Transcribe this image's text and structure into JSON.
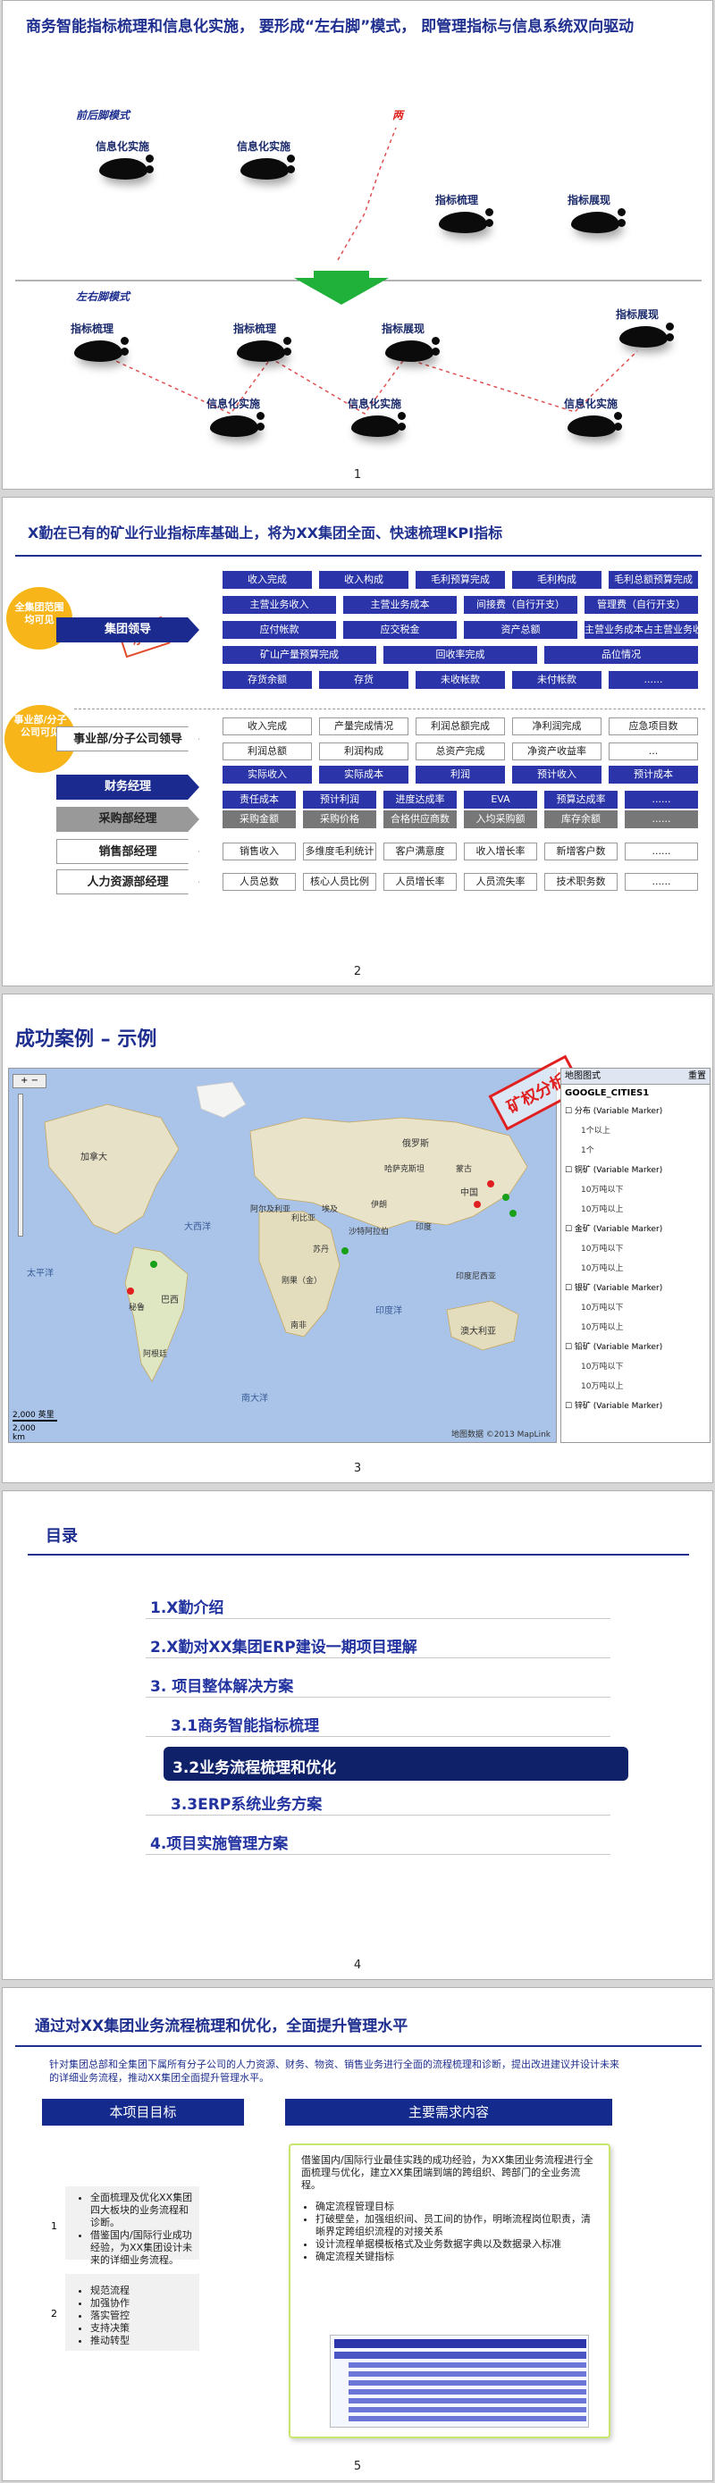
{
  "slide1": {
    "title": "商务智能指标梳理和信息化实施， 要形成“左右脚”模式， 即管理指标与信息系统双向驱动",
    "label_before": "前后脚模式",
    "label_gap": "两",
    "label_after": "左右脚模式",
    "before_feet": [
      "信息化实施",
      "信息化实施",
      "指标梳理",
      "指标展现"
    ],
    "after_top": [
      "指标梳理",
      "指标梳理",
      "指标展现",
      "指标展现"
    ],
    "after_bottom": [
      "信息化实施",
      "信息化实施",
      "信息化实施"
    ],
    "page": "1"
  },
  "slide2": {
    "title": "X勤在已有的矿业行业指标库基础上，将为XX集团全面、快速梳理KPI指标",
    "burst_a": "全集团范围均可见",
    "burst_b": "事业部/分子公司可见",
    "stamp": "示例",
    "rows": [
      {
        "label": "集团领导",
        "rows": [
          [
            "收入完成",
            "收入构成",
            "毛利预算完成",
            "毛利构成",
            "毛利总额预算完成"
          ],
          [
            "主营业务收入",
            "主营业务成本",
            "间接费（自行开支）",
            "管理费（自行开支）"
          ],
          [
            "应付帐款",
            "应交税金",
            "资产总额",
            "主营业务成本占主营业务收入比重"
          ],
          [
            "矿山产量预算完成",
            "回收率完成",
            "品位情况"
          ],
          [
            "存货余额",
            "存货",
            "未收帐款",
            "未付帐款",
            "......"
          ]
        ]
      },
      {
        "label": "事业部/分子公司领导",
        "rows": [
          [
            "收入完成",
            "产量完成情况",
            "利润总额完成",
            "净利润完成",
            "应急项目数"
          ],
          [
            "利润总额",
            "利润构成",
            "总资产完成",
            "净资产收益率",
            "..."
          ]
        ]
      },
      {
        "label": "财务经理",
        "rows": [
          [
            "实际收入",
            "实际成本",
            "利润",
            "预计收入",
            "预计成本"
          ],
          [
            "责任成本",
            "预计利润",
            "进度达成率",
            "EVA",
            "预算达成率",
            "......"
          ]
        ]
      },
      {
        "label": "采购部经理",
        "rows": [
          [
            "采购金额",
            "采购价格",
            "合格供应商数",
            "入均采购额",
            "库存余额",
            "......"
          ]
        ]
      },
      {
        "label": "销售部经理",
        "rows": [
          [
            "销售收入",
            "多维度毛利统计",
            "客户满意度",
            "收入增长率",
            "新增客户数",
            "......"
          ]
        ]
      },
      {
        "label": "人力资源部经理",
        "rows": [
          [
            "人员总数",
            "核心人员比例",
            "人员增长率",
            "人员流失率",
            "技术职务数",
            "......"
          ]
        ]
      }
    ],
    "page": "2"
  },
  "slide3": {
    "title": "成功案例 – 示例",
    "stamp": "矿权分析",
    "map_labels": [
      "加拿大",
      "大西洋",
      "太平洋",
      "印度洋",
      "南大洋",
      "阿尔及利亚",
      "利比亚",
      "埃及",
      "沙特阿拉伯",
      "中国",
      "俄罗斯",
      "哈萨克斯坦",
      "伊朗",
      "巴西",
      "秘鲁",
      "阿根廷",
      "苏丹",
      "刚果（金）",
      "南非",
      "澳大利亚",
      "印度尼西亚",
      "蒙古",
      "印度"
    ],
    "scale": [
      "2,000 英里",
      "2,000 km"
    ],
    "copyright": "地图数据 ©2013 MapLink",
    "panel_title": "地图图式",
    "panel_close": "重置",
    "panel_subtitle": "GOOGLE_CITIES1",
    "panel_items": [
      "☐ 分布 (Variable Marker)",
      "1个以上",
      "1个",
      "☐ 铜矿 (Variable Marker)",
      "10万吨以下",
      "10万吨以上",
      "☐ 金矿 (Variable Marker)",
      "10万吨以下",
      "10万吨以上",
      "☐ 银矿 (Variable Marker)",
      "10万吨以下",
      "10万吨以上",
      "☐ 铅矿 (Variable Marker)",
      "10万吨以下",
      "10万吨以上",
      "☐ 锌矿 (Variable Marker)"
    ],
    "page": "3"
  },
  "slide4": {
    "title": "目录",
    "items": [
      "1.X勤介绍",
      "2.X勤对XX集团ERP建设一期项目理解",
      "3. 项目整体解决方案",
      "3.1商务智能指标梳理",
      "3.2业务流程梳理和优化",
      "3.3ERP系统业务方案",
      "4.项目实施管理方案"
    ],
    "page": "4"
  },
  "slide5": {
    "title": "通过对XX集团业务流程梳理和优化，全面提升管理水平",
    "intro": "针对集团总部和全集团下属所有分子公司的人力资源、财务、物资、销售业务进行全面的流程梳理和诊断，提出改进建议并设计未来的详细业务流程，推动XX集团全面提升管理水平。",
    "left_header": "本项目目标",
    "right_header": "主要需求内容",
    "goals": [
      {
        "no": "1",
        "bullets": [
          "全面梳理及优化XX集团四大板块的业务流程和诊断。",
          "借鉴国内/国际行业成功经验，为XX集团设计未来的详细业务流程。"
        ]
      },
      {
        "no": "2",
        "bullets": [
          "规范流程",
          "加强协作",
          "落实管控",
          "支持决策",
          "推动转型"
        ]
      }
    ],
    "need_intro": "借鉴国内/国际行业最佳实践的成功经验，为XX集团业务流程进行全面梳理与优化，建立XX集团端到端的跨组织、跨部门的全业务流程。",
    "need_bullets": [
      "确定流程管理目标",
      "打破壁垒，加强组织间、员工间的协作，明晰流程岗位职责，清晰界定跨组织流程的对接关系",
      "设计流程单据模板格式及业务数据字典以及数据录入标准",
      "确定流程关键指标"
    ],
    "page": "5"
  }
}
